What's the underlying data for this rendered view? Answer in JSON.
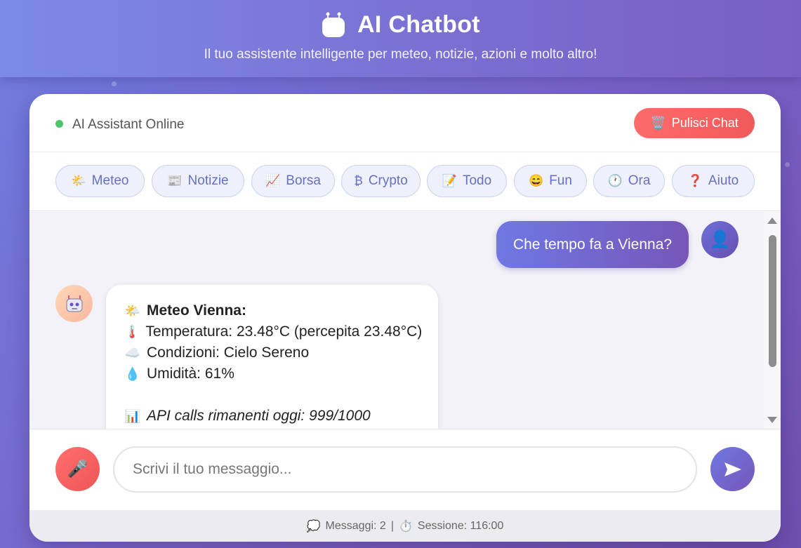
{
  "header": {
    "title": "AI Chatbot",
    "subtitle": "Il tuo assistente intelligente per meteo, notizie, azioni e molto altro!",
    "icon": "robot-icon"
  },
  "status": {
    "text": "AI Assistant Online",
    "color": "#4cc46a"
  },
  "clear_button": {
    "icon": "🗑️",
    "label": "Pulisci Chat"
  },
  "quick_actions": [
    {
      "icon": "🌤️",
      "label": "Meteo"
    },
    {
      "icon": "📰",
      "label": "Notizie"
    },
    {
      "icon": "📈",
      "label": "Borsa"
    },
    {
      "icon": "₿",
      "label": "Crypto"
    },
    {
      "icon": "📝",
      "label": "Todo"
    },
    {
      "icon": "😄",
      "label": "Fun"
    },
    {
      "icon": "🕐",
      "label": "Ora"
    },
    {
      "icon": "❓",
      "label": "Aiuto"
    }
  ],
  "messages": {
    "user": {
      "text": "Che tempo fa a Vienna?",
      "avatar_icon": "👤"
    },
    "bot": {
      "avatar_icon": "🤖",
      "lines": [
        {
          "icon": "🌤️",
          "text": "Meteo Vienna:"
        },
        {
          "icon": "🌡️",
          "text": "Temperatura: 23.48°C (percepita 23.48°C)"
        },
        {
          "icon": "☁️",
          "text": "Condizioni: Cielo Sereno"
        },
        {
          "icon": "💧",
          "text": "Umidità: 61%"
        },
        {
          "icon": "📊",
          "text": "API calls rimanenti oggi: 999/1000"
        }
      ]
    }
  },
  "input": {
    "placeholder": "Scrivi il tuo messaggio...",
    "value": "",
    "mic_icon": "🎤",
    "send_icon": "➤"
  },
  "footer": {
    "messages_icon": "💭",
    "messages_text": "Messaggi: 2",
    "separator": "|",
    "session_icon": "⏱️",
    "session_text": "Sessione: 116:00"
  },
  "colors": {
    "accent": "#6f78e3",
    "danger": "#f05a5a",
    "chip_text": "#6670c8"
  }
}
